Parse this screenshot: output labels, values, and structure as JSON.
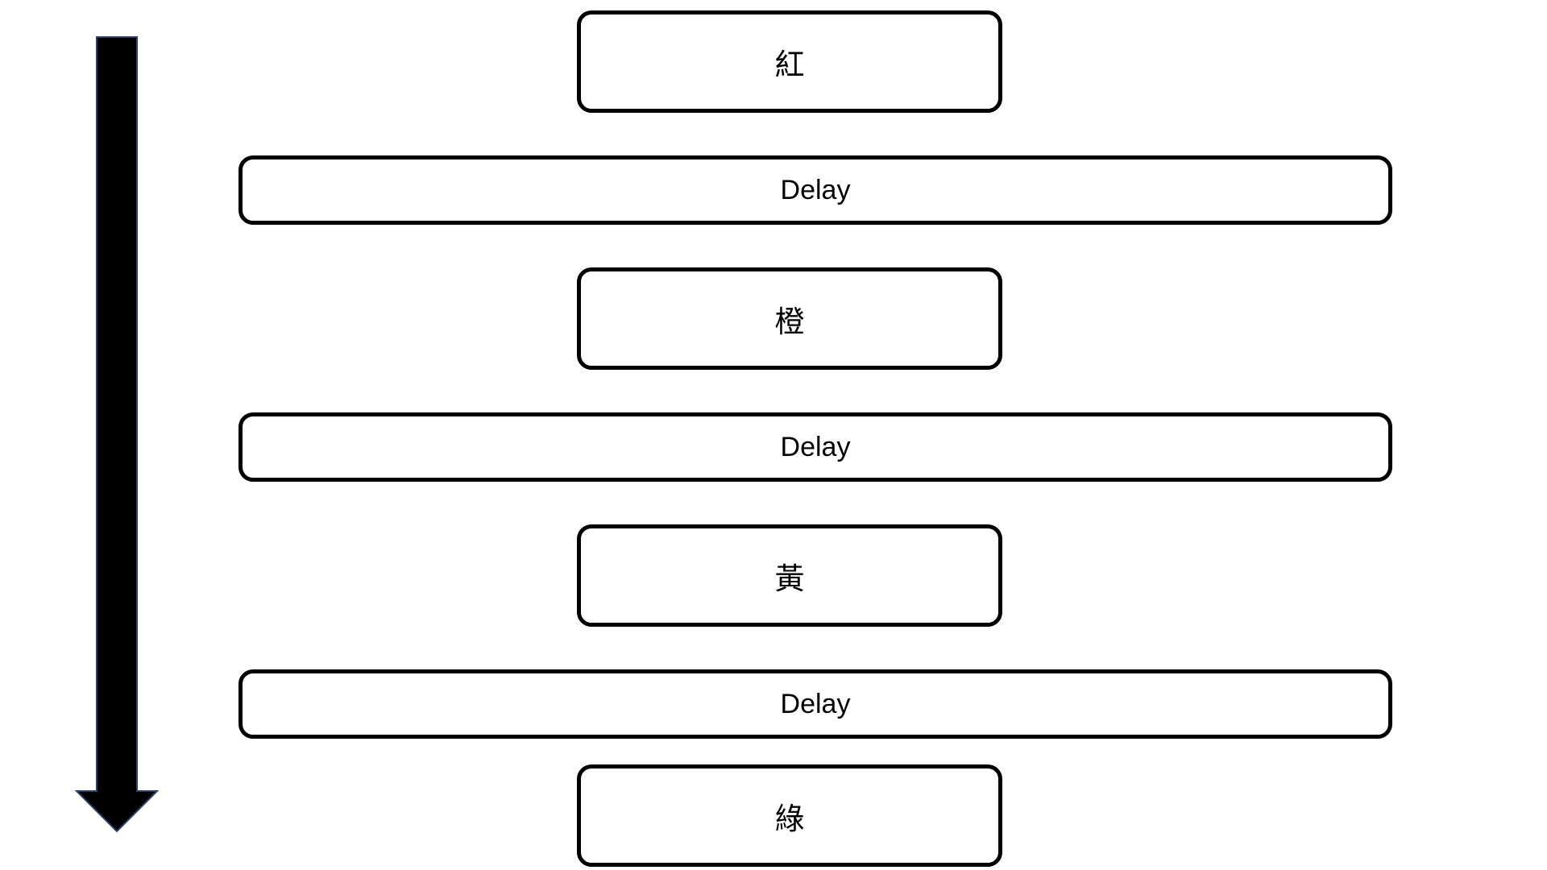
{
  "steps": [
    {
      "label": "紅"
    },
    {
      "label": "橙"
    },
    {
      "label": "黃"
    },
    {
      "label": "綠"
    }
  ],
  "delays": [
    {
      "label": "Delay"
    },
    {
      "label": "Delay"
    },
    {
      "label": "Delay"
    }
  ],
  "colors": {
    "stroke": "#000000",
    "arrow_fill": "#000000",
    "arrow_outline": "#2f3f6f",
    "background": "#ffffff"
  },
  "icons": {
    "flow_arrow": "down-arrow-icon"
  }
}
